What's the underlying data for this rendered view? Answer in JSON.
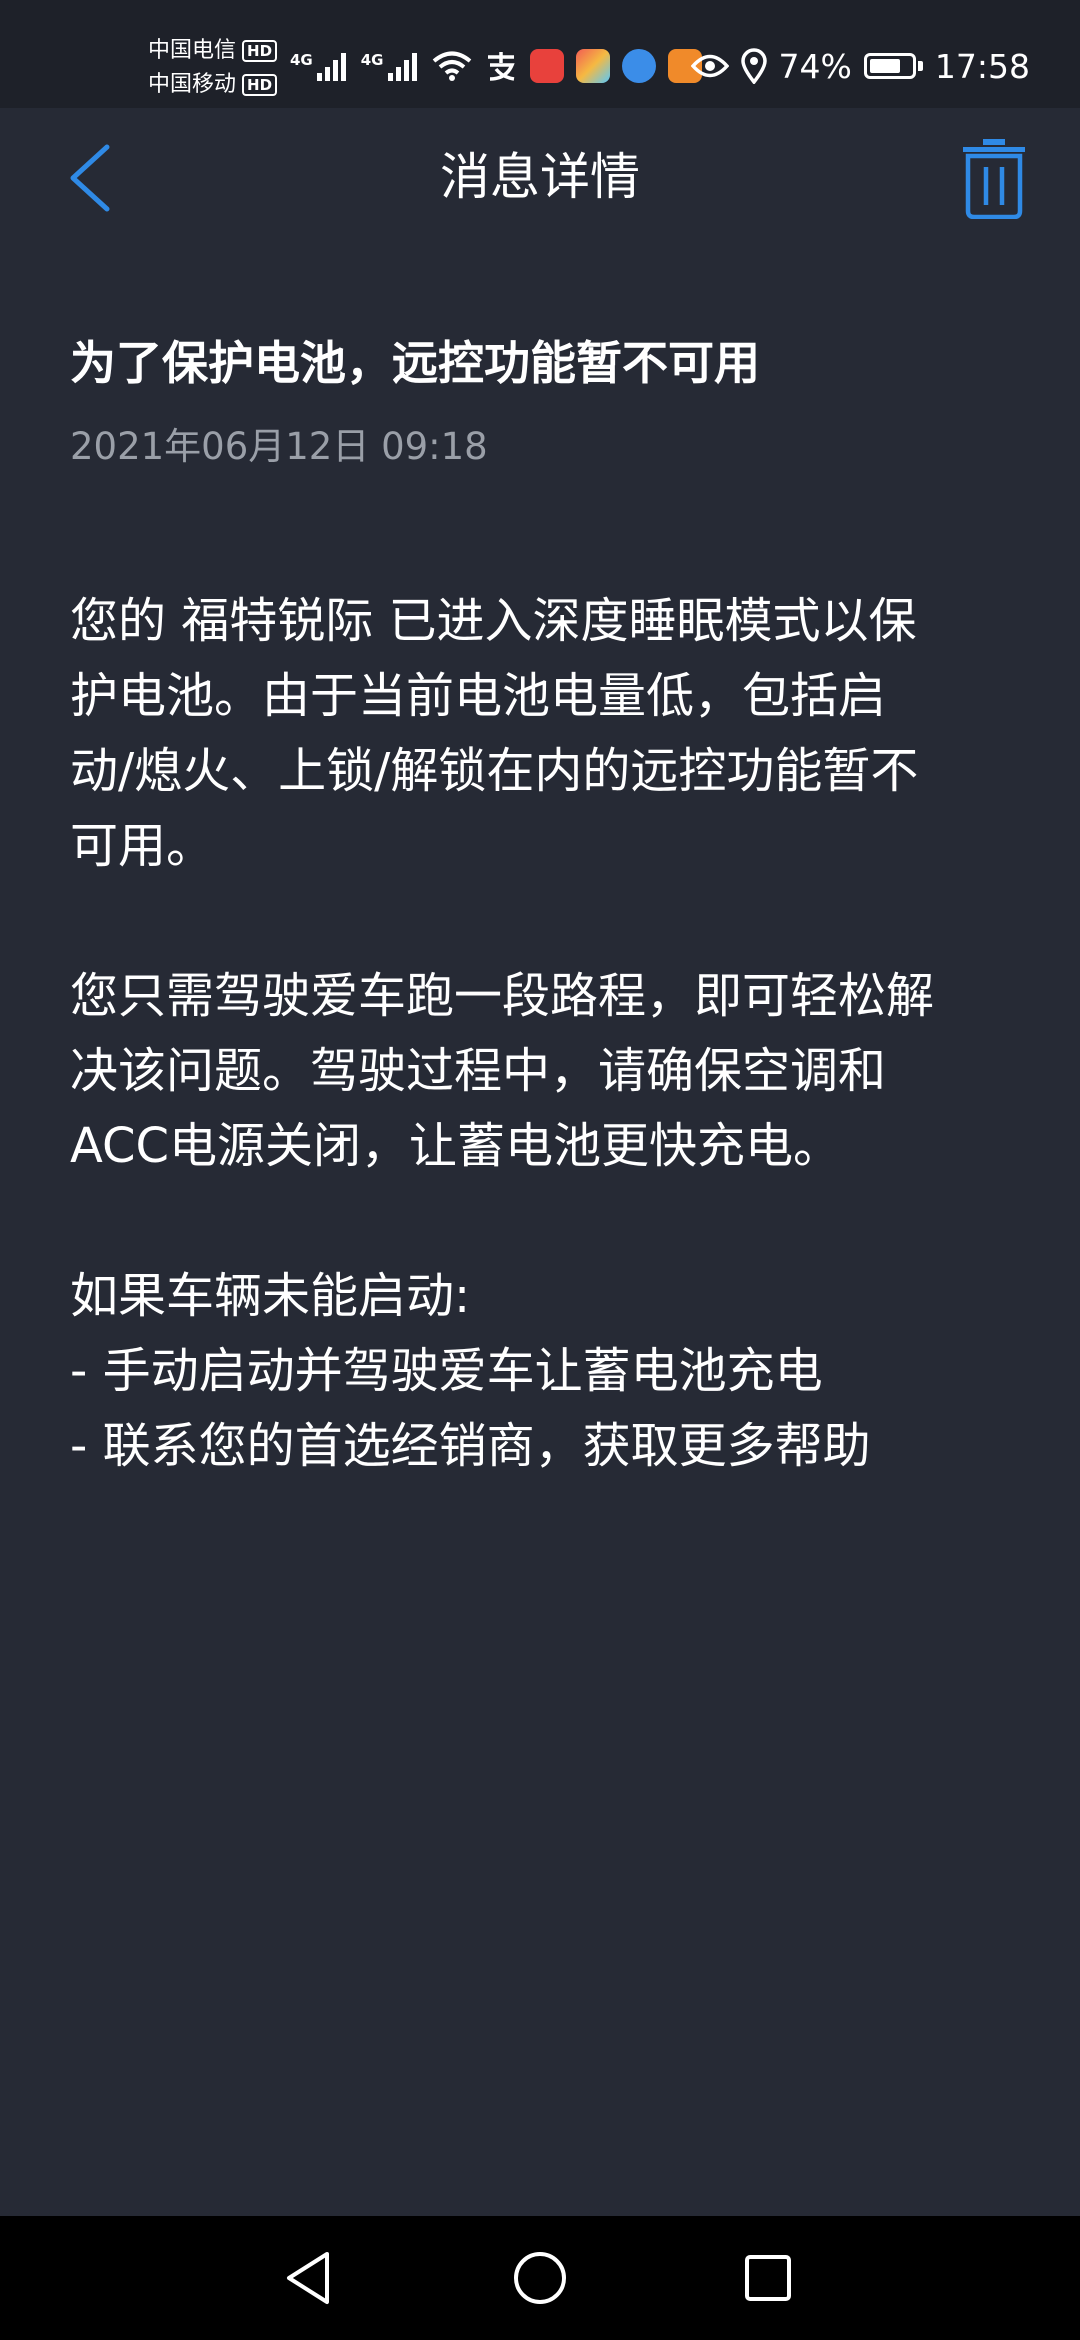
{
  "status_bar": {
    "carrier1": "中国电信",
    "carrier2": "中国移动",
    "hd_label": "HD",
    "network1": "4G",
    "network2": "4G",
    "battery_percent": "74%",
    "battery_level": 0.74,
    "time": "17:58",
    "app_icons": [
      {
        "name": "alipay-icon",
        "color": "#ffffff"
      },
      {
        "name": "app-red-icon",
        "color": "#e8413c"
      },
      {
        "name": "app-colorful-icon",
        "color": "#f5b942"
      },
      {
        "name": "app-blue-icon",
        "color": "#3b8de8"
      },
      {
        "name": "app-orange-icon",
        "color": "#f08a2a"
      }
    ]
  },
  "header": {
    "title": "消息详情"
  },
  "message": {
    "title": "为了保护电池，远控功能暂不可用",
    "date": "2021年06月12日 09:18",
    "paragraphs": [
      [
        "您的 福特锐际 已进入深度睡眠模式以保",
        "护电池。由于当前电池电量低，包括启",
        "动/熄火、上锁/解锁在内的远控功能暂不",
        "可用。"
      ],
      [
        "您只需驾驶爱车跑一段路程，即可轻松解",
        "决该问题。驾驶过程中，请确保空调和",
        "ACC电源关闭，让蓄电池更快充电。"
      ],
      [
        "如果车辆未能启动:",
        "- 手动启动并驾驶爱车让蓄电池充电",
        "- 联系您的首选经销商，获取更多帮助"
      ]
    ]
  },
  "colors": {
    "accent": "#2f8ae6",
    "background": "#262a35",
    "status_bar_bg": "#1e2129",
    "date_text": "#9a9fa8",
    "nav_bar_bg": "#000000"
  }
}
